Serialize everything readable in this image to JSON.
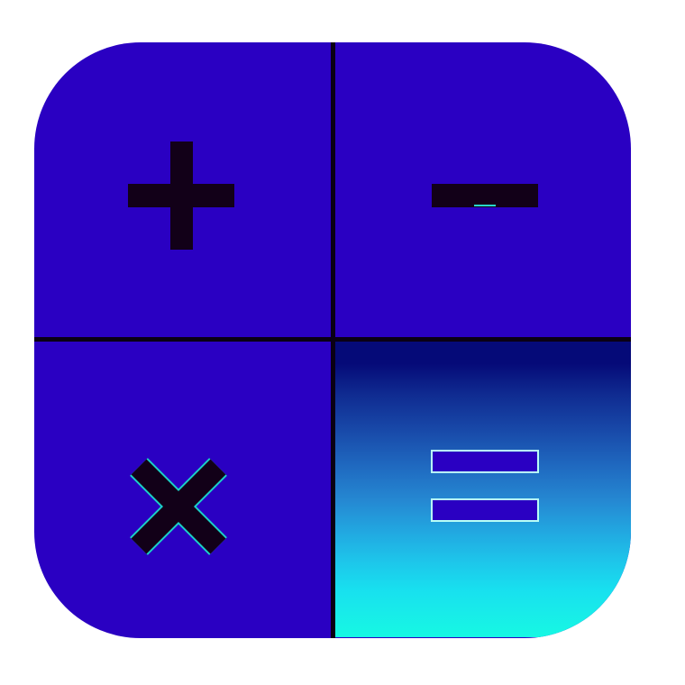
{
  "app_icon": {
    "name": "calculator-app-icon",
    "colors": {
      "background": "#2a00c2",
      "divider": "#0a0014",
      "symbol": "#120018",
      "gradient_top": "#050a78",
      "gradient_bottom": "#17f8e3"
    },
    "quadrants": [
      {
        "symbol": "plus-icon"
      },
      {
        "symbol": "minus-icon"
      },
      {
        "symbol": "multiply-icon"
      },
      {
        "symbol": "equals-icon"
      }
    ]
  }
}
